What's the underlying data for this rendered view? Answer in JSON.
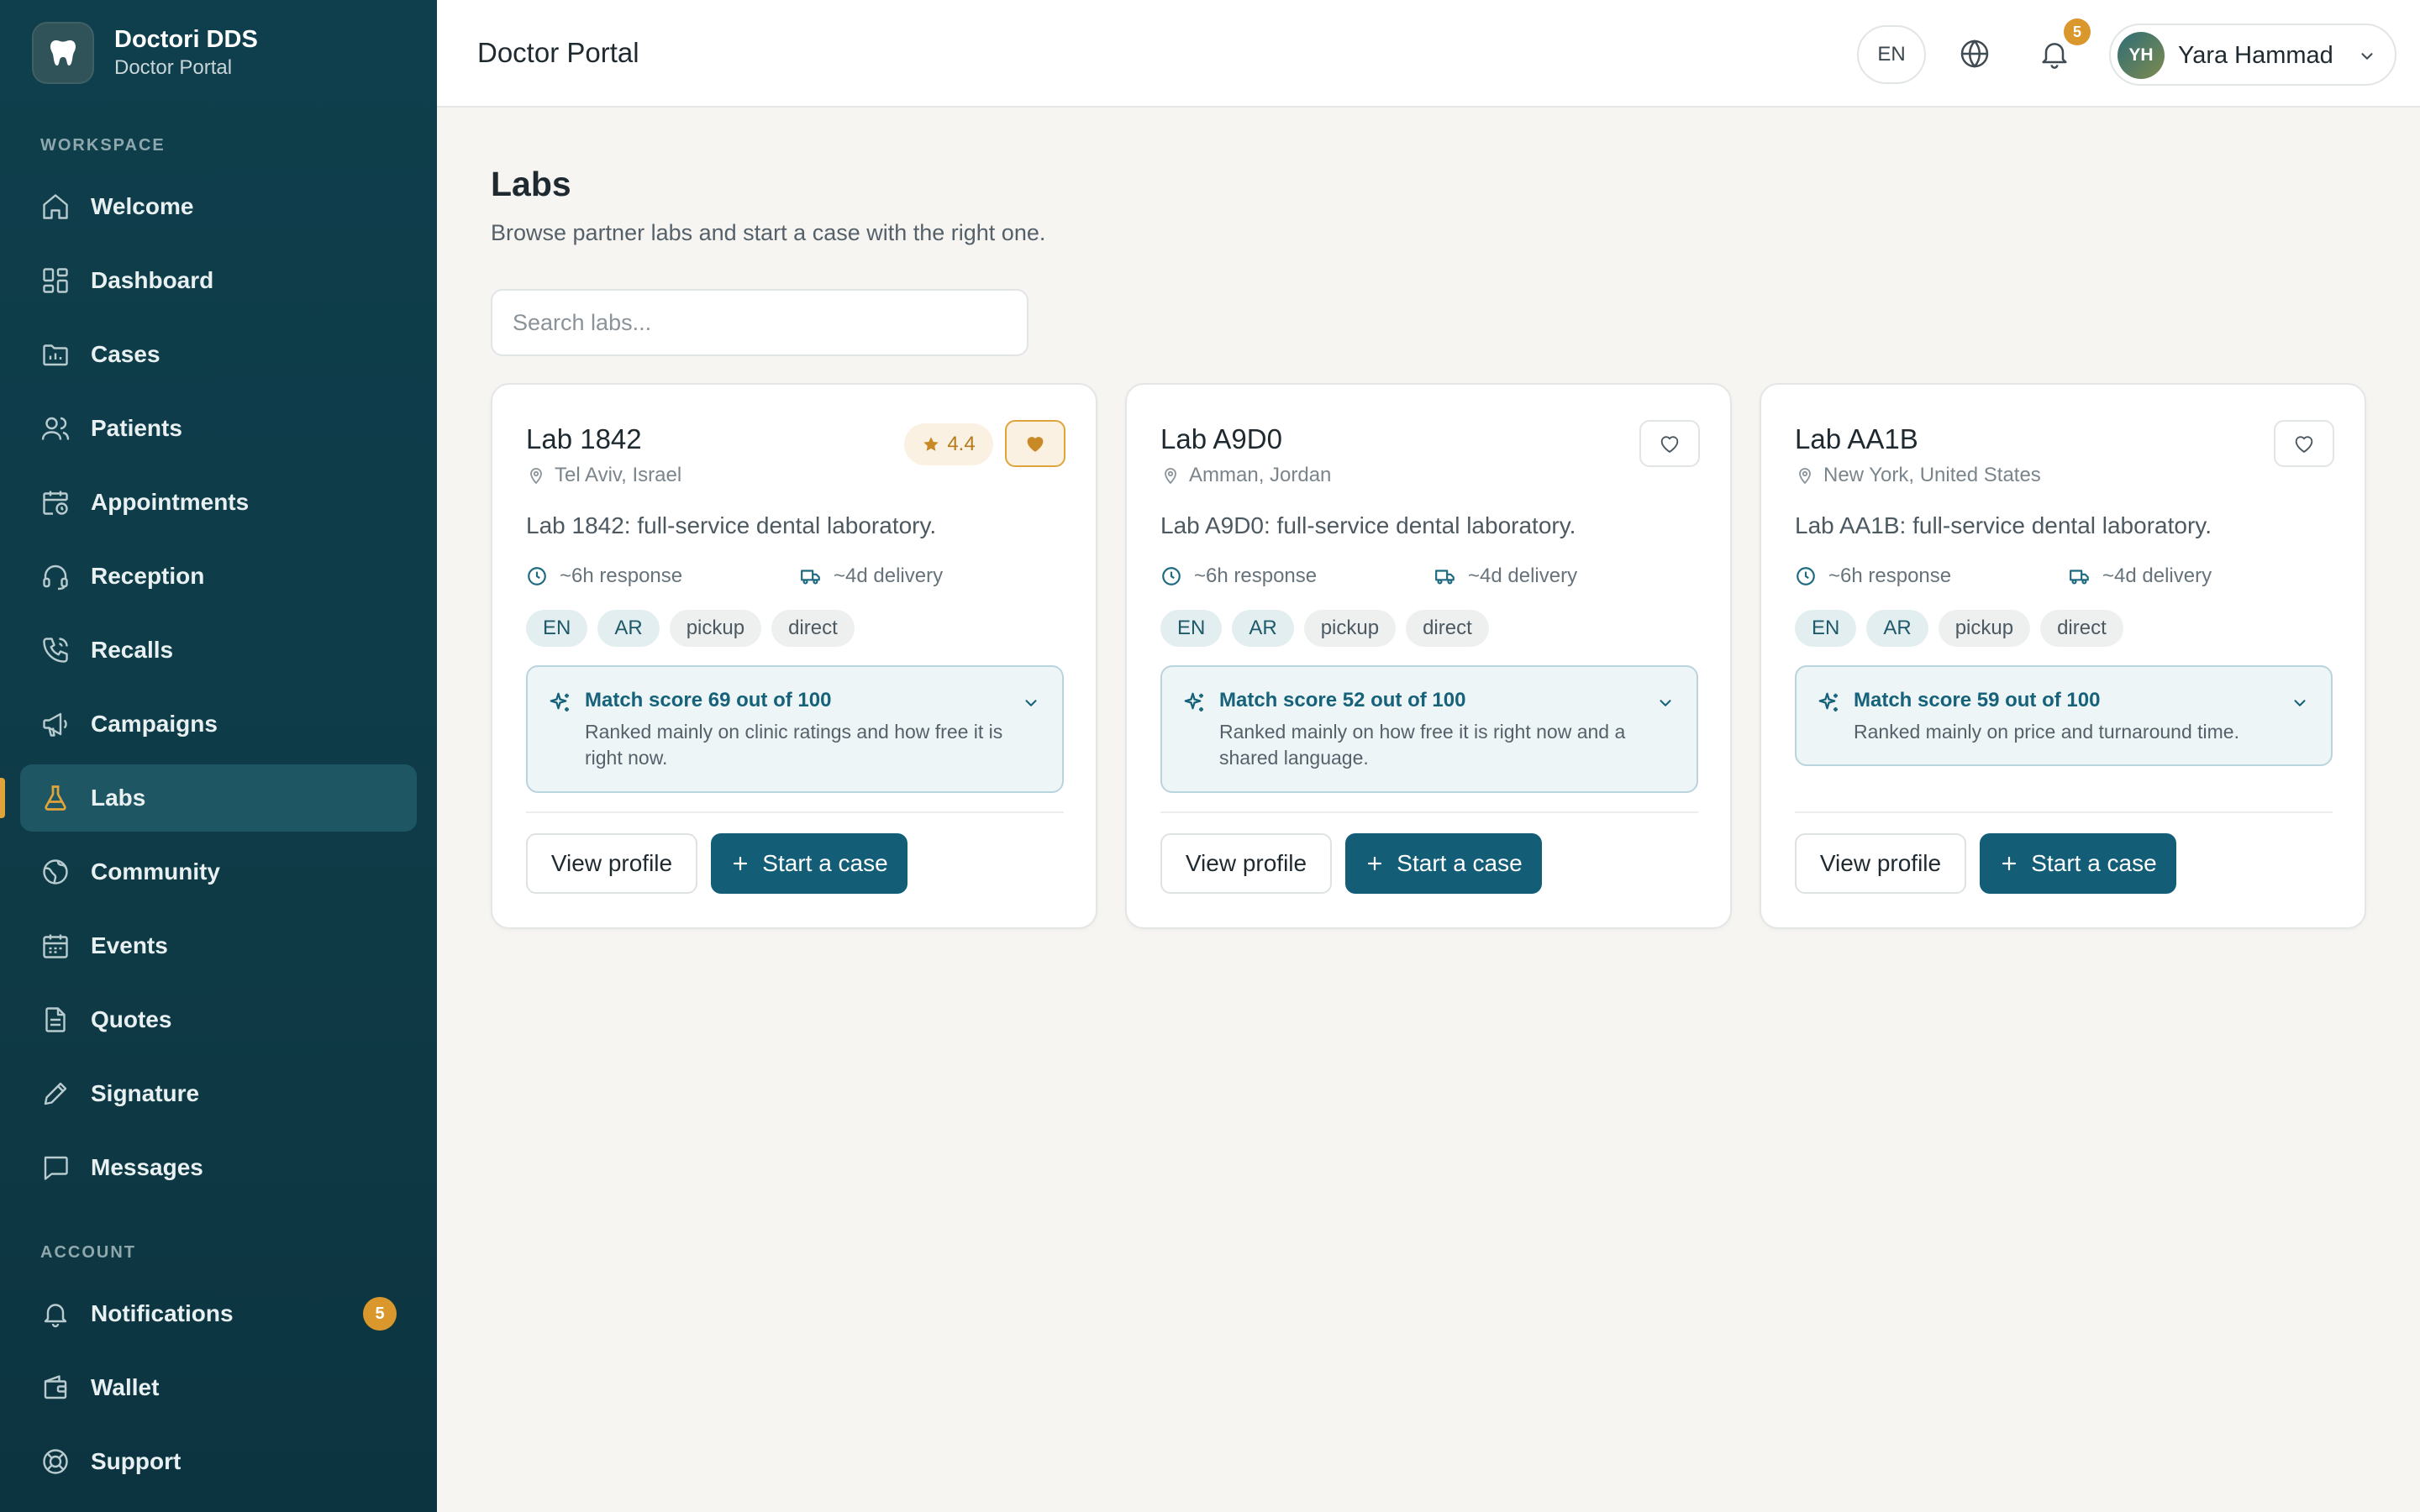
{
  "brand": {
    "name": "Doctori DDS",
    "subtitle": "Doctor Portal"
  },
  "sidebar": {
    "workspace_label": "WORKSPACE",
    "account_label": "ACCOUNT",
    "items": [
      {
        "label": "Welcome",
        "icon": "home-icon"
      },
      {
        "label": "Dashboard",
        "icon": "dashboard-icon"
      },
      {
        "label": "Cases",
        "icon": "folder-icon"
      },
      {
        "label": "Patients",
        "icon": "users-icon"
      },
      {
        "label": "Appointments",
        "icon": "calendar-clock-icon"
      },
      {
        "label": "Reception",
        "icon": "headset-icon"
      },
      {
        "label": "Recalls",
        "icon": "phone-icon"
      },
      {
        "label": "Campaigns",
        "icon": "megaphone-icon"
      },
      {
        "label": "Labs",
        "icon": "flask-icon",
        "active": true
      },
      {
        "label": "Community",
        "icon": "globe-icon"
      },
      {
        "label": "Events",
        "icon": "calendar-icon"
      },
      {
        "label": "Quotes",
        "icon": "document-icon"
      },
      {
        "label": "Signature",
        "icon": "pen-icon"
      },
      {
        "label": "Messages",
        "icon": "message-icon"
      }
    ],
    "account_items": [
      {
        "label": "Notifications",
        "icon": "bell-icon",
        "badge": "5"
      },
      {
        "label": "Wallet",
        "icon": "wallet-icon"
      },
      {
        "label": "Support",
        "icon": "lifebuoy-icon"
      }
    ]
  },
  "topbar": {
    "title": "Doctor Portal",
    "lang": "EN",
    "notifications_count": "5",
    "user": {
      "initials": "YH",
      "name": "Yara Hammad"
    }
  },
  "page": {
    "title": "Labs",
    "subtitle": "Browse partner labs and start a case with the right one.",
    "search_placeholder": "Search labs..."
  },
  "labs": [
    {
      "name": "Lab 1842",
      "location": "Tel Aviv, Israel",
      "rating": "4.4",
      "favorite": true,
      "description": "Lab 1842: full-service dental laboratory.",
      "response": "~6h response",
      "delivery": "~4d delivery",
      "tags": [
        "EN",
        "AR",
        "pickup",
        "direct"
      ],
      "match_title": "Match score 69 out of 100",
      "match_text": "Ranked mainly on clinic ratings and how free it is right now."
    },
    {
      "name": "Lab A9D0",
      "location": "Amman, Jordan",
      "favorite": false,
      "description": "Lab A9D0: full-service dental laboratory.",
      "response": "~6h response",
      "delivery": "~4d delivery",
      "tags": [
        "EN",
        "AR",
        "pickup",
        "direct"
      ],
      "match_title": "Match score 52 out of 100",
      "match_text": "Ranked mainly on how free it is right now and a shared language."
    },
    {
      "name": "Lab AA1B",
      "location": "New York, United States",
      "favorite": false,
      "description": "Lab AA1B: full-service dental laboratory.",
      "response": "~6h response",
      "delivery": "~4d delivery",
      "tags": [
        "EN",
        "AR",
        "pickup",
        "direct"
      ],
      "match_title": "Match score 59 out of 100",
      "match_text": "Ranked mainly on price and turnaround time."
    }
  ],
  "buttons": {
    "view_profile": "View profile",
    "start_case": "Start a case"
  },
  "colors": {
    "sidebar": "#0f3e4c",
    "accent": "#135d76",
    "badge": "#d9972c",
    "background": "#f6f5f2"
  }
}
